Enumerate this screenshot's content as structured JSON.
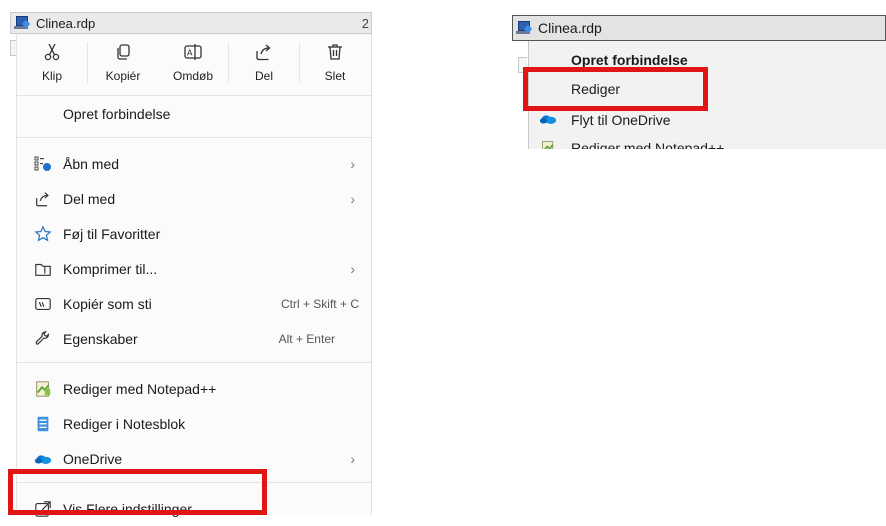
{
  "left": {
    "file_name": "Clinea.rdp",
    "file_suffix": "2",
    "toolbar": [
      {
        "label": "Klip",
        "icon": "scissors-icon"
      },
      {
        "label": "Kopiér",
        "icon": "copy-icon"
      },
      {
        "label": "Omdøb",
        "icon": "rename-icon"
      },
      {
        "label": "Del",
        "icon": "share-icon"
      },
      {
        "label": "Slet",
        "icon": "trash-icon"
      }
    ],
    "items": {
      "opret": {
        "label": "Opret forbindelse"
      },
      "aabn": {
        "label": "Åbn med",
        "icon": "open-with-icon"
      },
      "del_med": {
        "label": "Del med",
        "icon": "share-with-icon"
      },
      "favoritter": {
        "label": "Føj til Favoritter",
        "icon": "star-icon"
      },
      "komprimer": {
        "label": "Komprimer til...",
        "icon": "zip-folder-icon"
      },
      "kopier_sti": {
        "label": "Kopiér som sti",
        "shortcut": "Ctrl + Skift + C",
        "icon": "copy-path-icon"
      },
      "egenskaber": {
        "label": "Egenskaber",
        "shortcut": "Alt + Enter",
        "icon": "wrench-icon"
      },
      "notepadpp": {
        "label": "Rediger med Notepad++",
        "icon": "notepadpp-icon"
      },
      "notesblok": {
        "label": "Rediger i Notesblok",
        "icon": "notepad-icon"
      },
      "onedrive": {
        "label": "OneDrive",
        "icon": "onedrive-icon"
      },
      "flere": {
        "label": "Vis Flere indstillinger",
        "icon": "more-options-icon"
      }
    }
  },
  "right": {
    "file_name": "Clinea.rdp",
    "items": {
      "opret": {
        "label": "Opret forbindelse"
      },
      "rediger": {
        "label": "Rediger"
      },
      "flyt": {
        "label": "Flyt til OneDrive",
        "icon": "onedrive-icon"
      },
      "notepadpp": {
        "label": "Rediger med Notepad++",
        "icon": "notepadpp-icon"
      }
    }
  },
  "colors": {
    "highlight_red": "#e01616",
    "menu_bg": "#fbfbfb",
    "onedrive_blue": "#0f78d4"
  }
}
